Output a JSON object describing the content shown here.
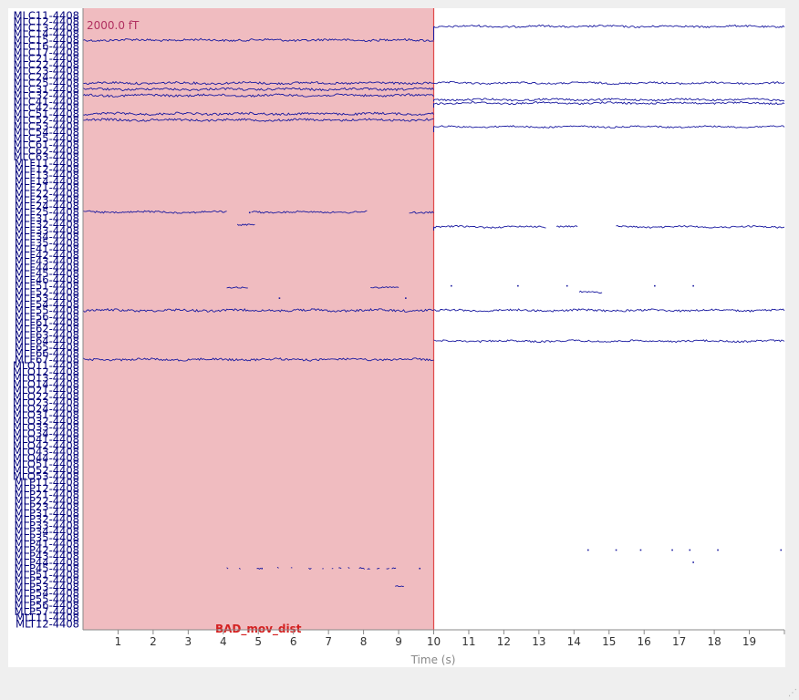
{
  "colors": {
    "trace": "#1a1aa0",
    "annotation_fill": "#f0bcc0",
    "annotation_edge": "#e04848",
    "axis": "#888888",
    "label": "#00007a",
    "scale": "#b03060"
  },
  "chart_data": {
    "type": "line",
    "title": "",
    "scale_bar_label": "2000.0 fT",
    "xlabel": "Time (s)",
    "xlim": [
      0,
      20
    ],
    "xticks": [
      1,
      2,
      3,
      4,
      5,
      6,
      7,
      8,
      9,
      10,
      11,
      12,
      13,
      14,
      15,
      16,
      17,
      18,
      19
    ],
    "channels": [
      "MLC11-4408",
      "MLC12-4408",
      "MLC13-4408",
      "MLC14-4408",
      "MLC15-4408",
      "MLC16-4408",
      "MLC17-4408",
      "MLC21-4408",
      "MLC22-4408",
      "MLC23-4408",
      "MLC24-4408",
      "MLC25-4408",
      "MLC31-4408",
      "MLC32-4408",
      "MLC41-4408",
      "MLC42-4408",
      "MLC51-4408",
      "MLC52-4408",
      "MLC53-4408",
      "MLC54-4408",
      "MLC55-4408",
      "MLC61-4408",
      "MLC62-4408",
      "MLC63-4408",
      "MLF11-4408",
      "MLF12-4408",
      "MLF13-4408",
      "MLF14-4408",
      "MLF21-4408",
      "MLF22-4408",
      "MLF23-4408",
      "MLF24-4408",
      "MLF25-4408",
      "MLF31-4408",
      "MLF32-4408",
      "MLF33-4408",
      "MLF34-4408",
      "MLF35-4408",
      "MLF41-4408",
      "MLF42-4408",
      "MLF43-4408",
      "MLF44-4408",
      "MLF45-4408",
      "MLF46-4408",
      "MLF51-4408",
      "MLF52-4408",
      "MLF53-4408",
      "MLF54-4408",
      "MLF55-4408",
      "MLF56-4408",
      "MLF61-4408",
      "MLF62-4408",
      "MLF63-4408",
      "MLF64-4408",
      "MLF65-4408",
      "MLF66-4408",
      "MLF67-4408",
      "MLO11-4408",
      "MLO12-4408",
      "MLO13-4408",
      "MLO14-4408",
      "MLO21-4408",
      "MLO22-4408",
      "MLO23-4408",
      "MLO24-4408",
      "MLO31-4408",
      "MLO32-4408",
      "MLO33-4408",
      "MLO34-4408",
      "MLO41-4408",
      "MLO42-4408",
      "MLO43-4408",
      "MLO44-4408",
      "MLO51-4408",
      "MLO52-4408",
      "MLO53-4408",
      "MLP11-4408",
      "MLP12-4408",
      "MLP21-4408",
      "MLP22-4408",
      "MLP23-4408",
      "MLP31-4408",
      "MLP32-4408",
      "MLP33-4408",
      "MLP34-4408",
      "MLP35-4408",
      "MLP41-4408",
      "MLP42-4408",
      "MLP43-4408",
      "MLP44-4408",
      "MLP45-4408",
      "MLP51-4408",
      "MLP52-4408",
      "MLP53-4408",
      "MLP54-4408",
      "MLP55-4408",
      "MLP56-4408",
      "MLP57-4408",
      "MLT11-4408",
      "MLT12-4408"
    ],
    "annotations": [
      {
        "label": "BAD_mov_dist",
        "onset": 0,
        "end": 10,
        "color": "#f0bcc0"
      }
    ],
    "segments": [
      {
        "ch": 4,
        "t0": 0,
        "t1": 10,
        "noise": 1.2
      },
      {
        "ch": 4,
        "t0": 10,
        "t1": 20,
        "noise": 1.0,
        "offset": -15
      },
      {
        "ch": 11,
        "t0": 0,
        "t1": 10,
        "noise": 1.2
      },
      {
        "ch": 11,
        "t0": 10,
        "t1": 20,
        "noise": 1.0
      },
      {
        "ch": 12,
        "t0": 0,
        "t1": 10,
        "noise": 1.2
      },
      {
        "ch": 13,
        "t0": 0,
        "t1": 10,
        "noise": 1.2
      },
      {
        "ch": 14,
        "t0": 10,
        "t1": 20,
        "noise": 1.0,
        "offset": -2
      },
      {
        "ch": 15,
        "t0": 10,
        "t1": 20,
        "noise": 1.0,
        "offset": -5
      },
      {
        "ch": 16,
        "t0": 0,
        "t1": 10,
        "noise": 1.2
      },
      {
        "ch": 17,
        "t0": 0,
        "t1": 10,
        "noise": 1.2
      },
      {
        "ch": 19,
        "t0": 10,
        "t1": 20,
        "noise": 0.8,
        "offset": -6
      },
      {
        "ch": 32,
        "t0": 0,
        "t1": 4.1,
        "noise": 1.0
      },
      {
        "ch": 32,
        "t0": 4.8,
        "t1": 8.1,
        "noise": 1.0
      },
      {
        "ch": 32,
        "t0": 9.3,
        "t1": 10,
        "noise": 1.0
      },
      {
        "ch": 34,
        "t0": 4.4,
        "t1": 4.9,
        "noise": 0.8
      },
      {
        "ch": 35,
        "t0": 10,
        "t1": 13.2,
        "noise": 0.9,
        "offset": -4
      },
      {
        "ch": 35,
        "t0": 13.5,
        "t1": 14.1,
        "noise": 0.9,
        "offset": -4
      },
      {
        "ch": 35,
        "t0": 15.2,
        "t1": 20,
        "noise": 0.9,
        "offset": -4
      },
      {
        "ch": 45,
        "t0": 14.15,
        "t1": 14.8,
        "noise": 0.8
      },
      {
        "ch": 46,
        "t0": 4.1,
        "t1": 4.7,
        "noise": 0.8,
        "offset": -12
      },
      {
        "ch": 46,
        "t0": 8.2,
        "t1": 9.0,
        "noise": 0.8,
        "offset": -12
      },
      {
        "ch": 48,
        "t0": 0,
        "t1": 10,
        "noise": 1.3
      },
      {
        "ch": 48,
        "t0": 10,
        "t1": 20,
        "noise": 1.1
      },
      {
        "ch": 53,
        "t0": 10,
        "t1": 20,
        "noise": 1.0
      },
      {
        "ch": 56,
        "t0": 0,
        "t1": 10,
        "noise": 1.2
      },
      {
        "ch": 90,
        "t0": 4.1,
        "t1": 9.0,
        "noise": 0.9,
        "gappy": true
      },
      {
        "ch": 94,
        "t0": 8.9,
        "t1": 9.15,
        "noise": 0.6,
        "offset": -8
      }
    ],
    "specks": [
      {
        "ch": 34,
        "t": 4.75,
        "offset": -13
      },
      {
        "ch": 44,
        "t": 10.5
      },
      {
        "ch": 44,
        "t": 12.4
      },
      {
        "ch": 44,
        "t": 13.8
      },
      {
        "ch": 44,
        "t": 16.3
      },
      {
        "ch": 44,
        "t": 17.4
      },
      {
        "ch": 46,
        "t": 5.6
      },
      {
        "ch": 46,
        "t": 9.2
      },
      {
        "ch": 87,
        "t": 14.4
      },
      {
        "ch": 87,
        "t": 15.2
      },
      {
        "ch": 87,
        "t": 15.9
      },
      {
        "ch": 87,
        "t": 16.8
      },
      {
        "ch": 87,
        "t": 17.3
      },
      {
        "ch": 87,
        "t": 18.1
      },
      {
        "ch": 87,
        "t": 19.9
      },
      {
        "ch": 90,
        "t": 5.1
      },
      {
        "ch": 90,
        "t": 9.6
      },
      {
        "ch": 89,
        "t": 17.4
      }
    ]
  }
}
